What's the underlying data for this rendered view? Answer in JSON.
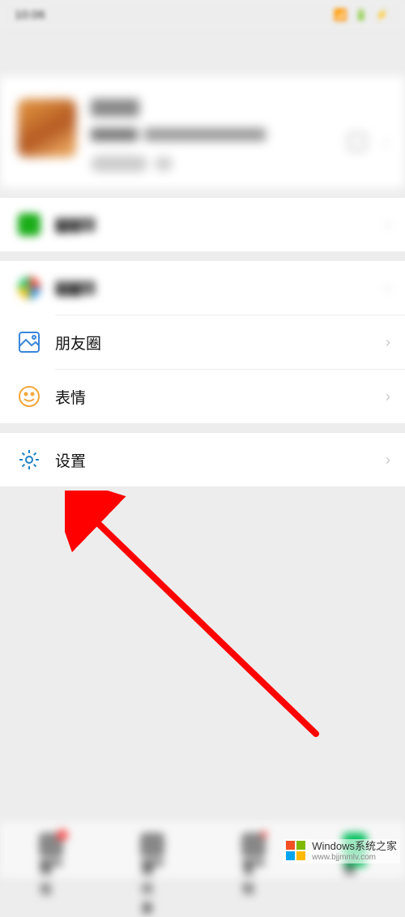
{
  "status": {
    "time": "10:06",
    "indicators": "📶 🔋 ⚡"
  },
  "profile": {
    "name_hidden": true,
    "id_hidden": true
  },
  "rows": {
    "services_label": "服务",
    "favorites_label": "收藏",
    "moments_label": "朋友圈",
    "stickers_label": "表情",
    "settings_label": "设置"
  },
  "nav": {
    "chats": "微信",
    "contacts": "通讯录",
    "discover": "发现",
    "me": "我"
  },
  "watermark": {
    "line1": "Windows系统之家",
    "line2": "www.bjjmmlv.com"
  },
  "colors": {
    "accent_green": "#07c160",
    "arrow_red": "#ff0000",
    "settings_blue": "#1f83c6",
    "moments_blue": "#3a86d9",
    "emoji_orange": "#f3a73a"
  }
}
